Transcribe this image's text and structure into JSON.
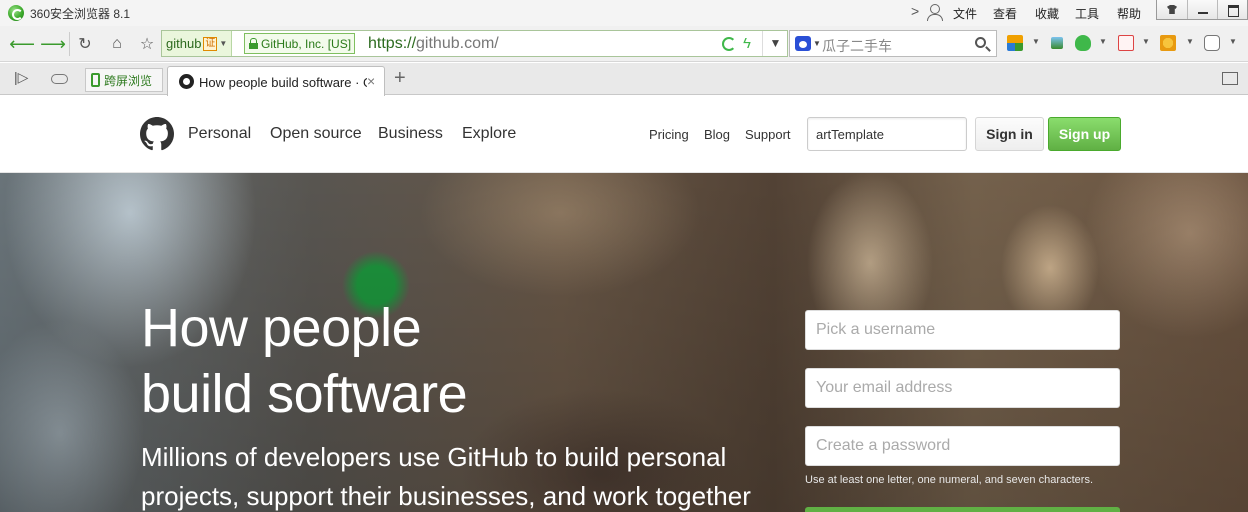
{
  "browser": {
    "app_title": "360安全浏览器 8.1",
    "menu": [
      "文件",
      "查看",
      "收藏",
      "工具",
      "帮助"
    ],
    "site_tag": "github",
    "site_tag_cert": "证",
    "ev_org": "GitHub, Inc. [US]",
    "url_scheme": "https://",
    "url_rest": "github.com/",
    "search_placeholder": "瓜子二手车",
    "phone_tab_label": "跨屏浏览",
    "active_tab_title": "How people build software · GitHub",
    "colors": {
      "accent_green": "#3a9a2d"
    }
  },
  "github": {
    "nav": [
      "Personal",
      "Open source",
      "Business",
      "Explore"
    ],
    "subnav": [
      "Pricing",
      "Blog",
      "Support"
    ],
    "search_value": "artTemplate",
    "signin_label": "Sign in",
    "signup_label": "Sign up",
    "hero": {
      "headline_line1": "How people",
      "headline_line2": "build software",
      "sub_line1": "Millions of developers use GitHub to build personal",
      "sub_line2": "projects, support their businesses, and work together"
    },
    "form": {
      "username_placeholder": "Pick a username",
      "email_placeholder": "Your email address",
      "password_placeholder": "Create a password",
      "password_hint": "Use at least one letter, one numeral, and seven characters."
    },
    "colors": {
      "signup_green": "#60b044"
    }
  }
}
